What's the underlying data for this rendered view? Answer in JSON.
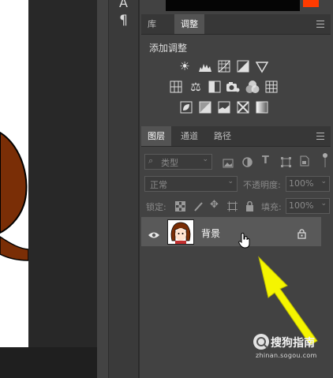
{
  "toolbar": {
    "text_tool_glyph": "A",
    "paragraph_tool_glyph": "¶"
  },
  "adjustments_panel": {
    "tabs": [
      "库",
      "调整"
    ],
    "active_tab": "调整",
    "title": "添加调整",
    "icons": [
      "brightness-icon",
      "levels-icon",
      "curves-icon",
      "exposure-icon",
      "vibrance-icon",
      "hue-saturation-icon",
      "color-balance-icon",
      "black-white-icon",
      "photo-filter-icon",
      "channel-mixer-icon",
      "color-lookup-icon",
      "invert-icon",
      "posterize-icon",
      "threshold-icon",
      "selective-color-icon",
      "gradient-map-icon"
    ]
  },
  "layers_panel": {
    "tabs": [
      "图层",
      "通道",
      "路径"
    ],
    "active_tab": "图层",
    "filter": {
      "placeholder": "类型"
    },
    "blend_mode": "正常",
    "opacity_label": "不透明度:",
    "opacity_value": "100%",
    "lock_label": "锁定:",
    "fill_label": "填充:",
    "fill_value": "100%",
    "layers": [
      {
        "name": "背景",
        "visible": true,
        "locked": true
      }
    ]
  },
  "watermark": {
    "brand": "搜狗指南",
    "url": "zhinan.sogou.com"
  },
  "colors": {
    "panel_bg": "#424242",
    "selected_layer_bg": "#595959",
    "arrow": "#f5f500",
    "brush_brown": "#7a2e06"
  }
}
